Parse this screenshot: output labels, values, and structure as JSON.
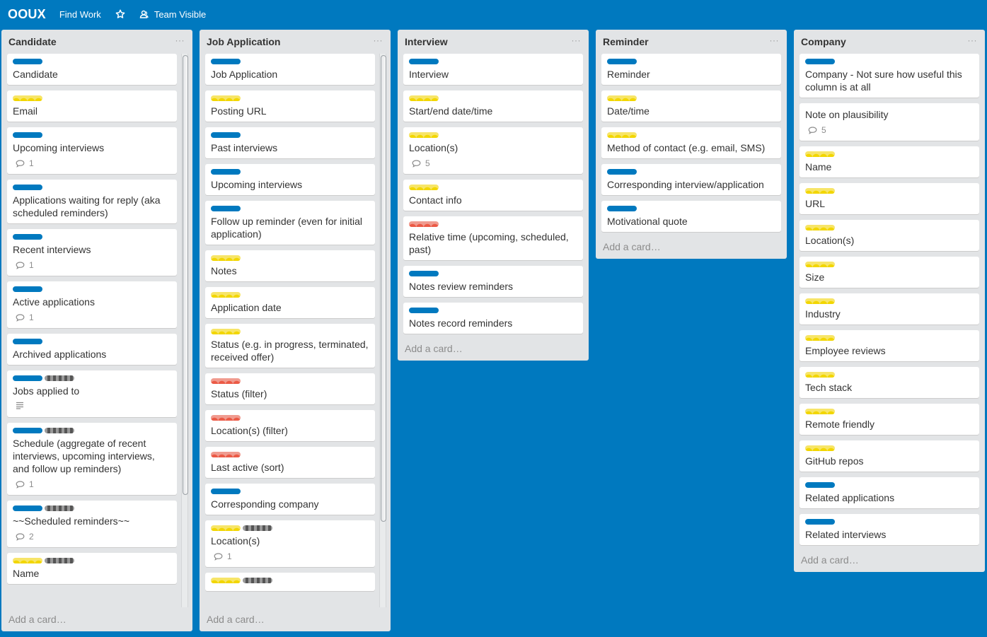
{
  "topbar": {
    "board_name": "OOUX",
    "team_link": "Find Work",
    "star_icon": "star-icon",
    "visibility_icon": "team-icon",
    "visibility_label": "Team Visible"
  },
  "colors": {
    "background": "#0079bf",
    "label_blue": "#0079bf",
    "label_yellow": "#f2d600",
    "label_red": "#eb5a46",
    "label_gray": "#838c91",
    "list_bg": "#e2e4e6"
  },
  "add_card_label": "Add a card…",
  "menu_label": "···",
  "lists": [
    {
      "title": "Candidate",
      "cards": [
        {
          "labels": [
            "blue"
          ],
          "title": "Candidate"
        },
        {
          "labels": [
            "yellow"
          ],
          "title": "Email"
        },
        {
          "labels": [
            "blue"
          ],
          "title": "Upcoming interviews",
          "comments": "1"
        },
        {
          "labels": [
            "blue"
          ],
          "title": "Applications waiting for reply (aka scheduled reminders)"
        },
        {
          "labels": [
            "blue"
          ],
          "title": "Recent interviews",
          "comments": "1"
        },
        {
          "labels": [
            "blue"
          ],
          "title": "Active applications",
          "comments": "1"
        },
        {
          "labels": [
            "blue"
          ],
          "title": "Archived applications"
        },
        {
          "labels": [
            "blue",
            "gray"
          ],
          "title": "Jobs applied to",
          "description": true
        },
        {
          "labels": [
            "blue",
            "gray"
          ],
          "title": "Schedule (aggregate of recent interviews, upcoming interviews, and follow up reminders)",
          "comments": "1"
        },
        {
          "labels": [
            "blue",
            "gray"
          ],
          "title": "~~Scheduled reminders~~",
          "comments": "2"
        },
        {
          "labels": [
            "yellow",
            "gray"
          ],
          "title": "Name"
        }
      ]
    },
    {
      "title": "Job Application",
      "cards": [
        {
          "labels": [
            "blue"
          ],
          "title": "Job Application"
        },
        {
          "labels": [
            "yellow"
          ],
          "title": "Posting URL"
        },
        {
          "labels": [
            "blue"
          ],
          "title": "Past interviews"
        },
        {
          "labels": [
            "blue"
          ],
          "title": "Upcoming interviews"
        },
        {
          "labels": [
            "blue"
          ],
          "title": "Follow up reminder (even for initial application)"
        },
        {
          "labels": [
            "yellow"
          ],
          "title": "Notes"
        },
        {
          "labels": [
            "yellow"
          ],
          "title": "Application date"
        },
        {
          "labels": [
            "yellow"
          ],
          "title": "Status (e.g. in progress, terminated, received offer)"
        },
        {
          "labels": [
            "red"
          ],
          "title": "Status (filter)"
        },
        {
          "labels": [
            "red"
          ],
          "title": "Location(s) (filter)"
        },
        {
          "labels": [
            "red"
          ],
          "title": "Last active (sort)"
        },
        {
          "labels": [
            "blue"
          ],
          "title": "Corresponding company"
        },
        {
          "labels": [
            "yellow",
            "gray"
          ],
          "title": "Location(s)",
          "comments": "1"
        },
        {
          "labels": [
            "yellow",
            "gray"
          ],
          "title": ""
        }
      ]
    },
    {
      "title": "Interview",
      "cards": [
        {
          "labels": [
            "blue"
          ],
          "title": "Interview"
        },
        {
          "labels": [
            "yellow"
          ],
          "title": "Start/end date/time"
        },
        {
          "labels": [
            "yellow"
          ],
          "title": "Location(s)",
          "comments": "5"
        },
        {
          "labels": [
            "yellow"
          ],
          "title": "Contact info"
        },
        {
          "labels": [
            "red"
          ],
          "title": "Relative time (upcoming, scheduled, past)"
        },
        {
          "labels": [
            "blue"
          ],
          "title": "Notes review reminders"
        },
        {
          "labels": [
            "blue"
          ],
          "title": "Notes record reminders"
        }
      ]
    },
    {
      "title": "Reminder",
      "cards": [
        {
          "labels": [
            "blue"
          ],
          "title": "Reminder"
        },
        {
          "labels": [
            "yellow"
          ],
          "title": "Date/time"
        },
        {
          "labels": [
            "yellow"
          ],
          "title": "Method of contact (e.g. email, SMS)"
        },
        {
          "labels": [
            "blue"
          ],
          "title": "Corresponding interview/application"
        },
        {
          "labels": [
            "blue"
          ],
          "title": "Motivational quote"
        }
      ]
    },
    {
      "title": "Company",
      "cards": [
        {
          "labels": [
            "blue"
          ],
          "title": "Company - Not sure how useful this column is at all"
        },
        {
          "labels": [],
          "title": "Note on plausibility",
          "comments": "5"
        },
        {
          "labels": [
            "yellow"
          ],
          "title": "Name"
        },
        {
          "labels": [
            "yellow"
          ],
          "title": "URL"
        },
        {
          "labels": [
            "yellow"
          ],
          "title": "Location(s)"
        },
        {
          "labels": [
            "yellow"
          ],
          "title": "Size"
        },
        {
          "labels": [
            "yellow"
          ],
          "title": "Industry"
        },
        {
          "labels": [
            "yellow"
          ],
          "title": "Employee reviews"
        },
        {
          "labels": [
            "yellow"
          ],
          "title": "Tech stack"
        },
        {
          "labels": [
            "yellow"
          ],
          "title": "Remote friendly"
        },
        {
          "labels": [
            "yellow"
          ],
          "title": "GitHub repos"
        },
        {
          "labels": [
            "blue"
          ],
          "title": "Related applications"
        },
        {
          "labels": [
            "blue"
          ],
          "title": "Related interviews"
        }
      ]
    }
  ]
}
